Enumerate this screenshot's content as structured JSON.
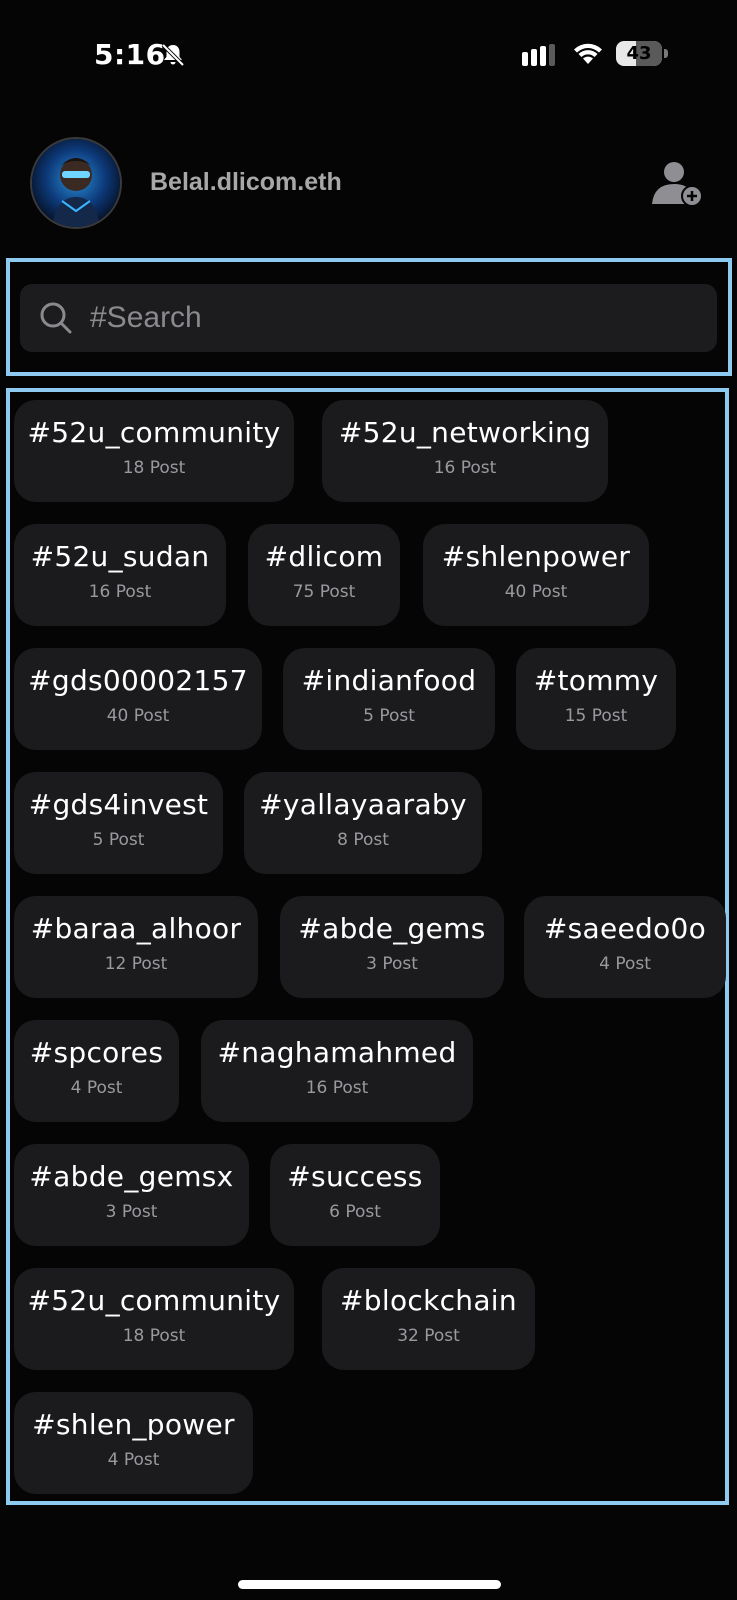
{
  "status_bar": {
    "time": "5:16",
    "battery": "43",
    "battery_level": 0.43
  },
  "profile": {
    "username": "Belal.dlicom.eth"
  },
  "search": {
    "placeholder": "#Search"
  },
  "tags": [
    {
      "name": "#52u_community",
      "count": "18 Post"
    },
    {
      "name": "#52u_networking",
      "count": "16 Post"
    },
    {
      "name": "#52u_sudan",
      "count": "16 Post"
    },
    {
      "name": "#dlicom",
      "count": "75 Post"
    },
    {
      "name": "#shlenpower",
      "count": "40 Post"
    },
    {
      "name": "#gds00002157",
      "count": "40 Post"
    },
    {
      "name": "#indianfood",
      "count": "5 Post"
    },
    {
      "name": "#tommy",
      "count": "15 Post"
    },
    {
      "name": "#gds4invest",
      "count": "5 Post"
    },
    {
      "name": "#yallayaaraby",
      "count": "8 Post"
    },
    {
      "name": "#baraa_alhoor",
      "count": "12 Post"
    },
    {
      "name": "#abde_gems",
      "count": "3 Post"
    },
    {
      "name": "#saeedo0o",
      "count": "4 Post"
    },
    {
      "name": "#spcores",
      "count": "4 Post"
    },
    {
      "name": "#naghamahmed",
      "count": "16 Post"
    },
    {
      "name": "#abde_gemsx",
      "count": "3 Post"
    },
    {
      "name": "#success",
      "count": "6 Post"
    },
    {
      "name": "#52u_community",
      "count": "18 Post"
    },
    {
      "name": "#blockchain",
      "count": "32 Post"
    },
    {
      "name": "#shlen_power",
      "count": "4 Post"
    }
  ]
}
